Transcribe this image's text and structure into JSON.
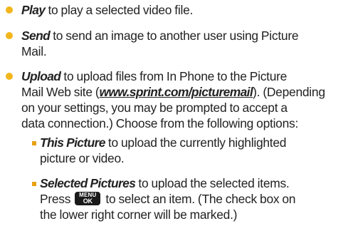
{
  "colors": {
    "bullet": "#f2b61b",
    "sub_bullet": "#e8a212",
    "text": "#222222",
    "key_bg": "#1a1a1a"
  },
  "items": [
    {
      "term": "Play",
      "text": " to play a selected video file."
    },
    {
      "term": "Send",
      "text1": " to send an image to another user using Picture",
      "text2": "Mail."
    },
    {
      "term": "Upload",
      "text1": " to upload files from In Phone to the Picture",
      "text2_pre": "Mail Web site (",
      "link": "www.sprint.com/picturemail",
      "text2_post": "). (Depending",
      "text3": "on your settings, you may be prompted to accept a",
      "text4": "data connection.) Choose from the following options:",
      "sub_items": [
        {
          "term": "This Picture",
          "text1": " to upload the currently highlighted",
          "text2": "picture or video."
        },
        {
          "term": "Selected Pictures",
          "text1": " to upload the selected items.",
          "text2_pre": "Press ",
          "key_top": "MENU",
          "key_bottom": "OK",
          "key_icon": "menu-ok-key-icon",
          "text2_post": " to select an item. (The check box on",
          "text3": "the lower right corner will be marked.)"
        }
      ]
    }
  ]
}
